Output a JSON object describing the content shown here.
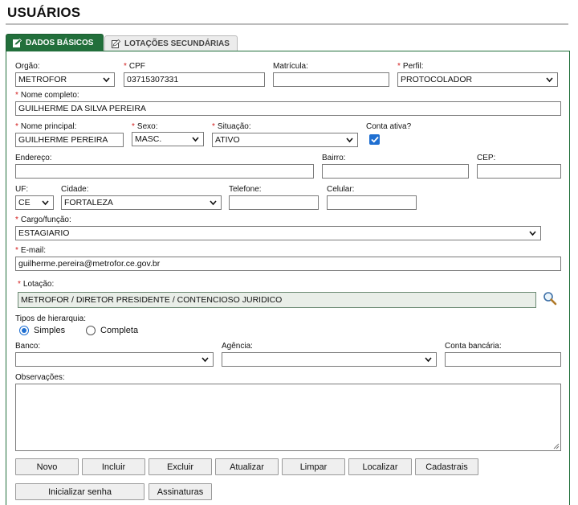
{
  "page": {
    "title": "USUÁRIOS"
  },
  "tabs": [
    {
      "label": "DADOS BÁSICOS",
      "icon": "edit-icon",
      "active": true
    },
    {
      "label": "LOTAÇÕES SECUNDÁRIAS",
      "icon": "edit-icon",
      "active": false
    }
  ],
  "colors": {
    "accent": "#226f3b",
    "required": "#d21b1b",
    "checkbox": "#1f6fd1"
  },
  "form": {
    "orgao": {
      "label": "Orgão:",
      "value": "METROFOR"
    },
    "cpf": {
      "label": "CPF",
      "value": "03715307331"
    },
    "matricula": {
      "label": "Matrícula:",
      "value": ""
    },
    "perfil": {
      "label": "Perfil:",
      "value": "PROTOCOLADOR"
    },
    "nome_completo": {
      "label": "Nome completo:",
      "value": "GUILHERME DA SILVA PEREIRA"
    },
    "nome_principal": {
      "label": "Nome principal:",
      "value": "GUILHERME PEREIRA"
    },
    "sexo": {
      "label": "Sexo:",
      "value": "MASC."
    },
    "situacao": {
      "label": "Situação:",
      "value": "ATIVO"
    },
    "conta_ativa": {
      "label": "Conta ativa?",
      "checked": true
    },
    "endereco": {
      "label": "Endereço:",
      "value": ""
    },
    "bairro": {
      "label": "Bairro:",
      "value": ""
    },
    "cep": {
      "label": "CEP:",
      "value": ""
    },
    "uf": {
      "label": "UF:",
      "value": "CE"
    },
    "cidade": {
      "label": "Cidade:",
      "value": "FORTALEZA"
    },
    "telefone": {
      "label": "Telefone:",
      "value": ""
    },
    "celular": {
      "label": "Celular:",
      "value": ""
    },
    "cargo": {
      "label": "Cargo/função:",
      "value": "ESTAGIARIO"
    },
    "email": {
      "label": "E-mail:",
      "value": "guilherme.pereira@metrofor.ce.gov.br"
    },
    "lotacao": {
      "label": "Lotação:",
      "value": "METROFOR / DIRETOR PRESIDENTE / CONTENCIOSO JURIDICO"
    },
    "hierarquia": {
      "label": "Tipos de hierarquia:",
      "options": [
        {
          "label": "Simples",
          "selected": true
        },
        {
          "label": "Completa",
          "selected": false
        }
      ]
    },
    "banco": {
      "label": "Banco:",
      "value": ""
    },
    "agencia": {
      "label": "Agência:",
      "value": ""
    },
    "conta_bancaria": {
      "label": "Conta bancária:",
      "value": ""
    },
    "observacoes": {
      "label": "Observações:",
      "value": ""
    }
  },
  "buttons": {
    "novo": "Novo",
    "incluir": "Incluir",
    "excluir": "Excluir",
    "atualizar": "Atualizar",
    "limpar": "Limpar",
    "localizar": "Localizar",
    "cadastrais": "Cadastrais",
    "inicializar_senha": "Inicializar senha",
    "assinaturas": "Assinaturas"
  }
}
